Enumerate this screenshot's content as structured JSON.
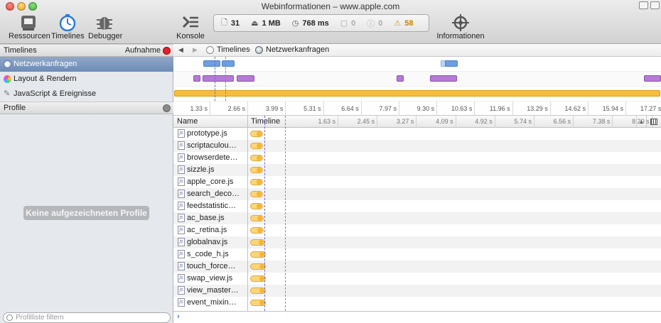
{
  "window": {
    "title": "Webinformationen – www.apple.com"
  },
  "toolbar": {
    "ressourcen": "Ressourcen",
    "timelines": "Timelines",
    "debugger": "Debugger",
    "konsole": "Konsole",
    "informationen": "Informationen"
  },
  "status": {
    "requests": "31",
    "size": "1 MB",
    "time": "768 ms",
    "errors": "0",
    "issues": "0",
    "warnings": "58"
  },
  "sidebar": {
    "timelines_header": "Timelines",
    "record_label": "Aufnahme",
    "items": [
      {
        "label": "Netzwerkanfragen"
      },
      {
        "label": "Layout & Rendern"
      },
      {
        "label": "JavaScript & Ereignisse"
      }
    ],
    "profile_header": "Profile",
    "no_profiles": "Keine aufgezeichneten Profile",
    "filter_placeholder": "Profilliste filtern"
  },
  "breadcrumb": {
    "root": "Timelines",
    "current": "Netzwerkanfragen"
  },
  "ruler_ticks": [
    "1.33 s",
    "2.66 s",
    "3.99 s",
    "5.31 s",
    "6.64 s",
    "7.97 s",
    "9.30 s",
    "10.63 s",
    "11.96 s",
    "13.29 s",
    "14.62 s",
    "15.94 s",
    "17.27 s"
  ],
  "grid": {
    "col_name": "Name",
    "col_timeline": "Timeline",
    "ticks": [
      "1.63 s",
      "2.45 s",
      "3.27 s",
      "4.09 s",
      "4.92 s",
      "5.74 s",
      "6.56 s",
      "7.38 s",
      "8.20 s"
    ],
    "rows": [
      {
        "name": "prototype.js"
      },
      {
        "name": "scriptaculou…"
      },
      {
        "name": "browserdete…"
      },
      {
        "name": "sizzle.js"
      },
      {
        "name": "apple_core.js"
      },
      {
        "name": "search_deco…"
      },
      {
        "name": "feedstatistic…"
      },
      {
        "name": "ac_base.js"
      },
      {
        "name": "ac_retina.js"
      },
      {
        "name": "globalnav.js"
      },
      {
        "name": "s_code_h.js"
      },
      {
        "name": "touch_force…"
      },
      {
        "name": "swap_view.js"
      },
      {
        "name": "view_master…"
      },
      {
        "name": "event_mixin…"
      }
    ]
  },
  "colors": {
    "network": "#6e9fe3",
    "layout": "#b57ad6",
    "script": "#f6bd3d",
    "selected": "#7c95bd"
  }
}
